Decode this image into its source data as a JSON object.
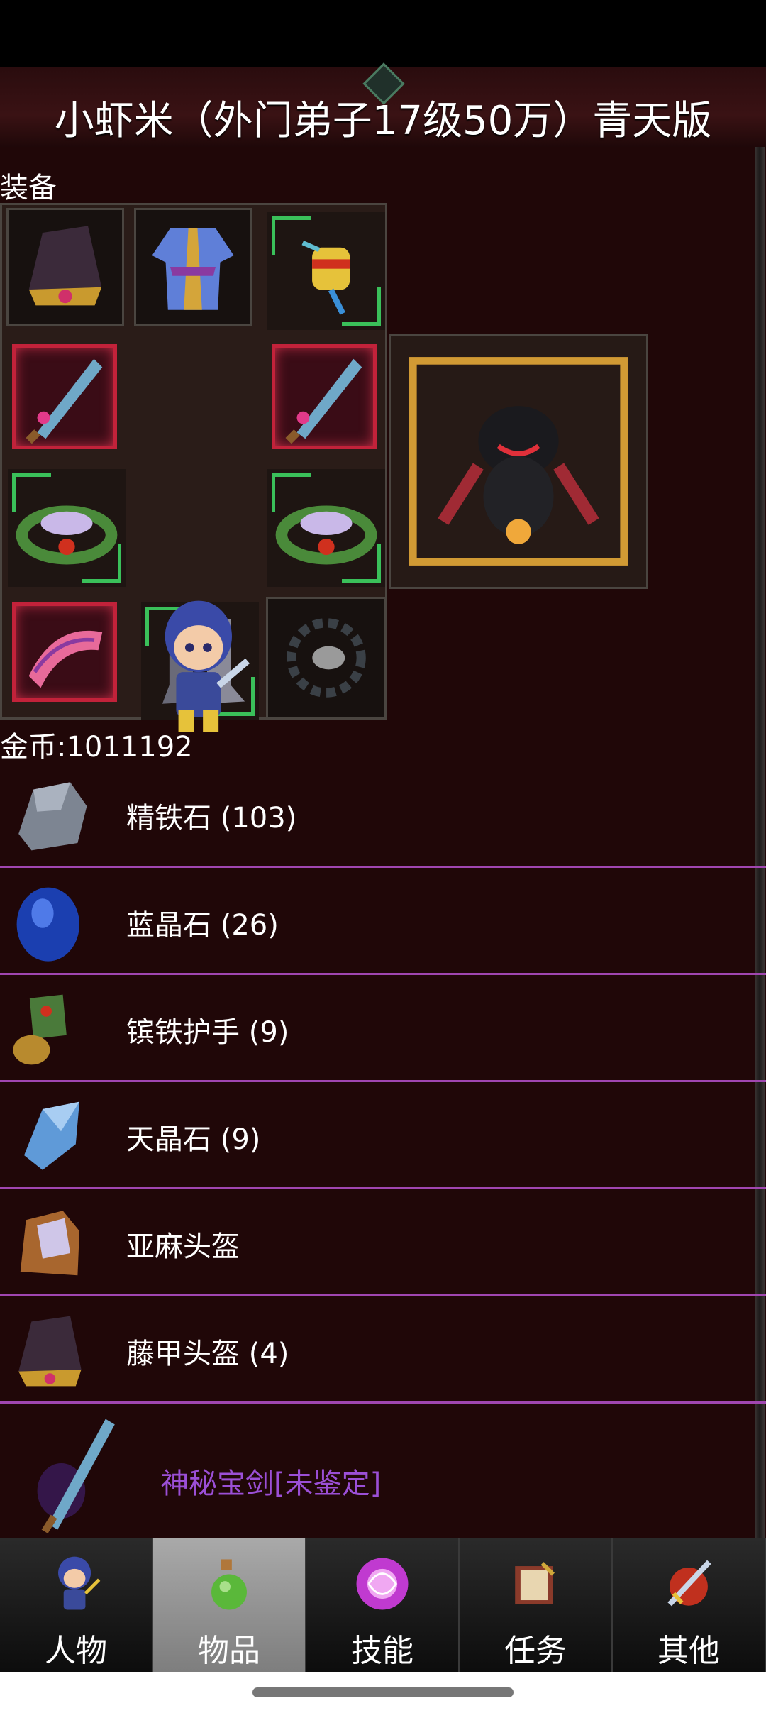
{
  "title": "小虾米（外门弟子17级50万）青天版",
  "equipment": {
    "label": "装备"
  },
  "gold": {
    "label": "金币:1011192"
  },
  "items": [
    {
      "name": "精铁石 (103)",
      "icon": "iron-ore-icon"
    },
    {
      "name": "蓝晶石 (26)",
      "icon": "blue-crystal-icon"
    },
    {
      "name": "镔铁护手 (9)",
      "icon": "gauntlet-icon"
    },
    {
      "name": "天晶石 (9)",
      "icon": "sky-crystal-icon"
    },
    {
      "name": "亚麻头盔",
      "icon": "linen-helmet-icon"
    },
    {
      "name": "藤甲头盔 (4)",
      "icon": "rattan-helmet-icon"
    },
    {
      "name": "神秘宝剑[未鉴定]",
      "icon": "mystery-sword-icon"
    }
  ],
  "nav": {
    "tabs": [
      {
        "label": "人物"
      },
      {
        "label": "物品"
      },
      {
        "label": "技能"
      },
      {
        "label": "任务"
      },
      {
        "label": "其他"
      }
    ],
    "active": "物品"
  },
  "colors": {
    "background": "#200708",
    "divider": "#a046b0",
    "unidentified_item": "#9b4fd6",
    "rarity_green": "#3ac05a",
    "rarity_red": "#c2223a"
  }
}
